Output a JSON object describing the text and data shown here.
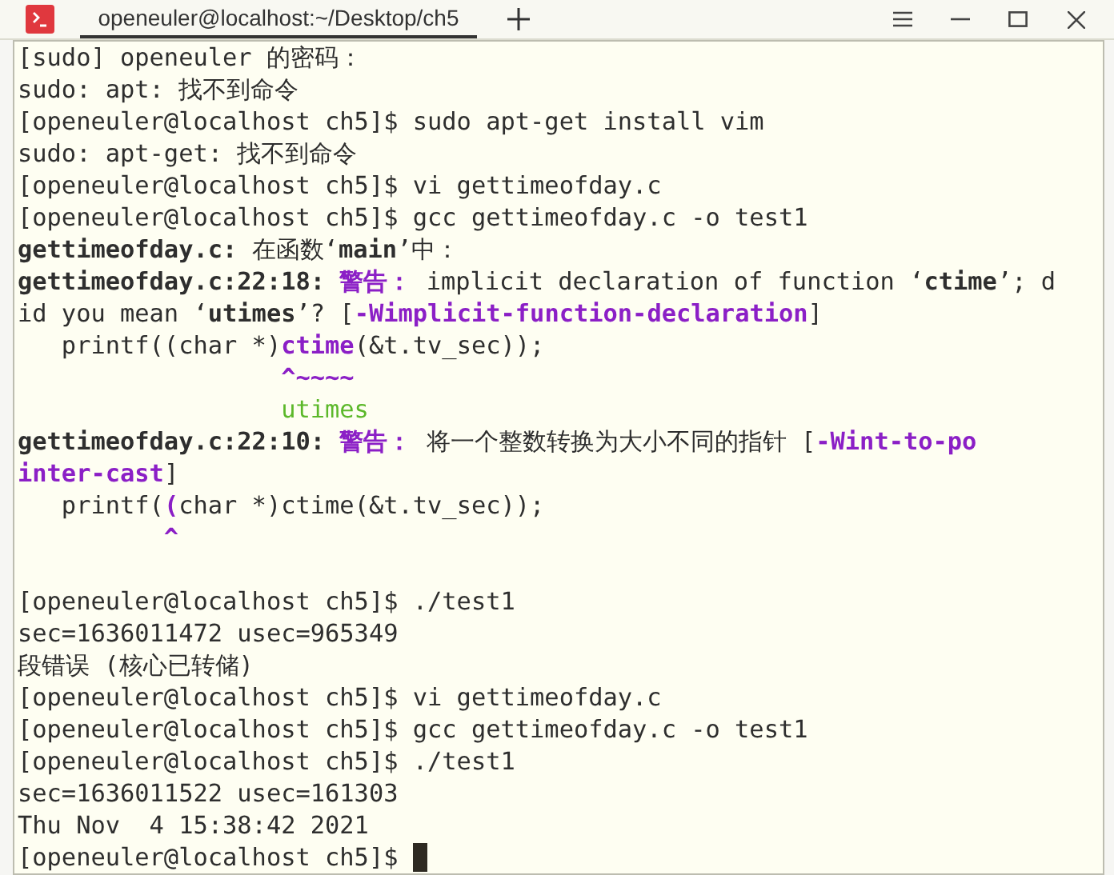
{
  "window": {
    "tab_title": "openeuler@localhost:~/Desktop/ch5"
  },
  "terminal": {
    "cursor_visible": true,
    "lines": [
      {
        "kind": "text",
        "segments": [
          {
            "kind": "normal",
            "text": "[sudo] openeuler 的密码："
          }
        ]
      },
      {
        "kind": "text",
        "segments": [
          {
            "kind": "normal",
            "text": "sudo: apt: 找不到命令"
          }
        ]
      },
      {
        "kind": "text",
        "segments": [
          {
            "kind": "normal",
            "text": "[openeuler@localhost ch5]$ sudo apt-get install vim"
          }
        ]
      },
      {
        "kind": "text",
        "segments": [
          {
            "kind": "normal",
            "text": "sudo: apt-get: 找不到命令"
          }
        ]
      },
      {
        "kind": "text",
        "segments": [
          {
            "kind": "normal",
            "text": "[openeuler@localhost ch5]$ vi gettimeofday.c"
          }
        ]
      },
      {
        "kind": "text",
        "segments": [
          {
            "kind": "normal",
            "text": "[openeuler@localhost ch5]$ gcc gettimeofday.c -o test1"
          }
        ]
      },
      {
        "kind": "text",
        "segments": [
          {
            "kind": "bold",
            "text": "gettimeofday.c:"
          },
          {
            "kind": "normal",
            "text": " 在函数‘"
          },
          {
            "kind": "bold",
            "text": "main"
          },
          {
            "kind": "normal",
            "text": "’中："
          }
        ]
      },
      {
        "kind": "text",
        "segments": [
          {
            "kind": "bold",
            "text": "gettimeofday.c:22:18:"
          },
          {
            "kind": "warning",
            "text": " 警告："
          },
          {
            "kind": "normal",
            "text": " implicit declaration of function ‘"
          },
          {
            "kind": "bold",
            "text": "ctime"
          },
          {
            "kind": "normal",
            "text": "’; d"
          }
        ]
      },
      {
        "kind": "text",
        "segments": [
          {
            "kind": "normal",
            "text": "id you mean ‘"
          },
          {
            "kind": "bold",
            "text": "utimes"
          },
          {
            "kind": "normal",
            "text": "’? ["
          },
          {
            "kind": "warning",
            "text": "-Wimplicit-function-declaration"
          },
          {
            "kind": "normal",
            "text": "]"
          }
        ]
      },
      {
        "kind": "text",
        "segments": [
          {
            "kind": "normal",
            "text": "   printf((char *)"
          },
          {
            "kind": "warning",
            "text": "ctime"
          },
          {
            "kind": "normal",
            "text": "(&t.tv_sec));"
          }
        ]
      },
      {
        "kind": "text",
        "segments": [
          {
            "kind": "warning",
            "text": "                  ^~~~~"
          }
        ]
      },
      {
        "kind": "text",
        "segments": [
          {
            "kind": "fixit",
            "text": "                  utimes"
          }
        ]
      },
      {
        "kind": "text",
        "segments": [
          {
            "kind": "bold",
            "text": "gettimeofday.c:22:10:"
          },
          {
            "kind": "warning",
            "text": " 警告："
          },
          {
            "kind": "normal",
            "text": " 将一个整数转换为大小不同的指针 ["
          },
          {
            "kind": "warning",
            "text": "-Wint-to-po"
          }
        ]
      },
      {
        "kind": "text",
        "segments": [
          {
            "kind": "warning",
            "text": "inter-cast"
          },
          {
            "kind": "normal",
            "text": "]"
          }
        ]
      },
      {
        "kind": "text",
        "segments": [
          {
            "kind": "normal",
            "text": "   printf("
          },
          {
            "kind": "warning",
            "text": "("
          },
          {
            "kind": "normal",
            "text": "char *)ctime(&t.tv_sec));"
          }
        ]
      },
      {
        "kind": "text",
        "segments": [
          {
            "kind": "warning",
            "text": "          ^"
          }
        ]
      },
      {
        "kind": "blank"
      },
      {
        "kind": "text",
        "segments": [
          {
            "kind": "normal",
            "text": "[openeuler@localhost ch5]$ ./test1"
          }
        ]
      },
      {
        "kind": "text",
        "segments": [
          {
            "kind": "normal",
            "text": "sec=1636011472 usec=965349"
          }
        ]
      },
      {
        "kind": "text",
        "segments": [
          {
            "kind": "normal",
            "text": "段错误 (核心已转储)"
          }
        ]
      },
      {
        "kind": "text",
        "segments": [
          {
            "kind": "normal",
            "text": "[openeuler@localhost ch5]$ vi gettimeofday.c"
          }
        ]
      },
      {
        "kind": "text",
        "segments": [
          {
            "kind": "normal",
            "text": "[openeuler@localhost ch5]$ gcc gettimeofday.c -o test1"
          }
        ]
      },
      {
        "kind": "text",
        "segments": [
          {
            "kind": "normal",
            "text": "[openeuler@localhost ch5]$ ./test1"
          }
        ]
      },
      {
        "kind": "text",
        "segments": [
          {
            "kind": "normal",
            "text": "sec=1636011522 usec=161303"
          }
        ]
      },
      {
        "kind": "text",
        "segments": [
          {
            "kind": "normal",
            "text": "Thu Nov  4 15:38:42 2021"
          }
        ]
      },
      {
        "kind": "text",
        "segments": [
          {
            "kind": "normal",
            "text": "[openeuler@localhost ch5]$"
          }
        ]
      }
    ]
  }
}
